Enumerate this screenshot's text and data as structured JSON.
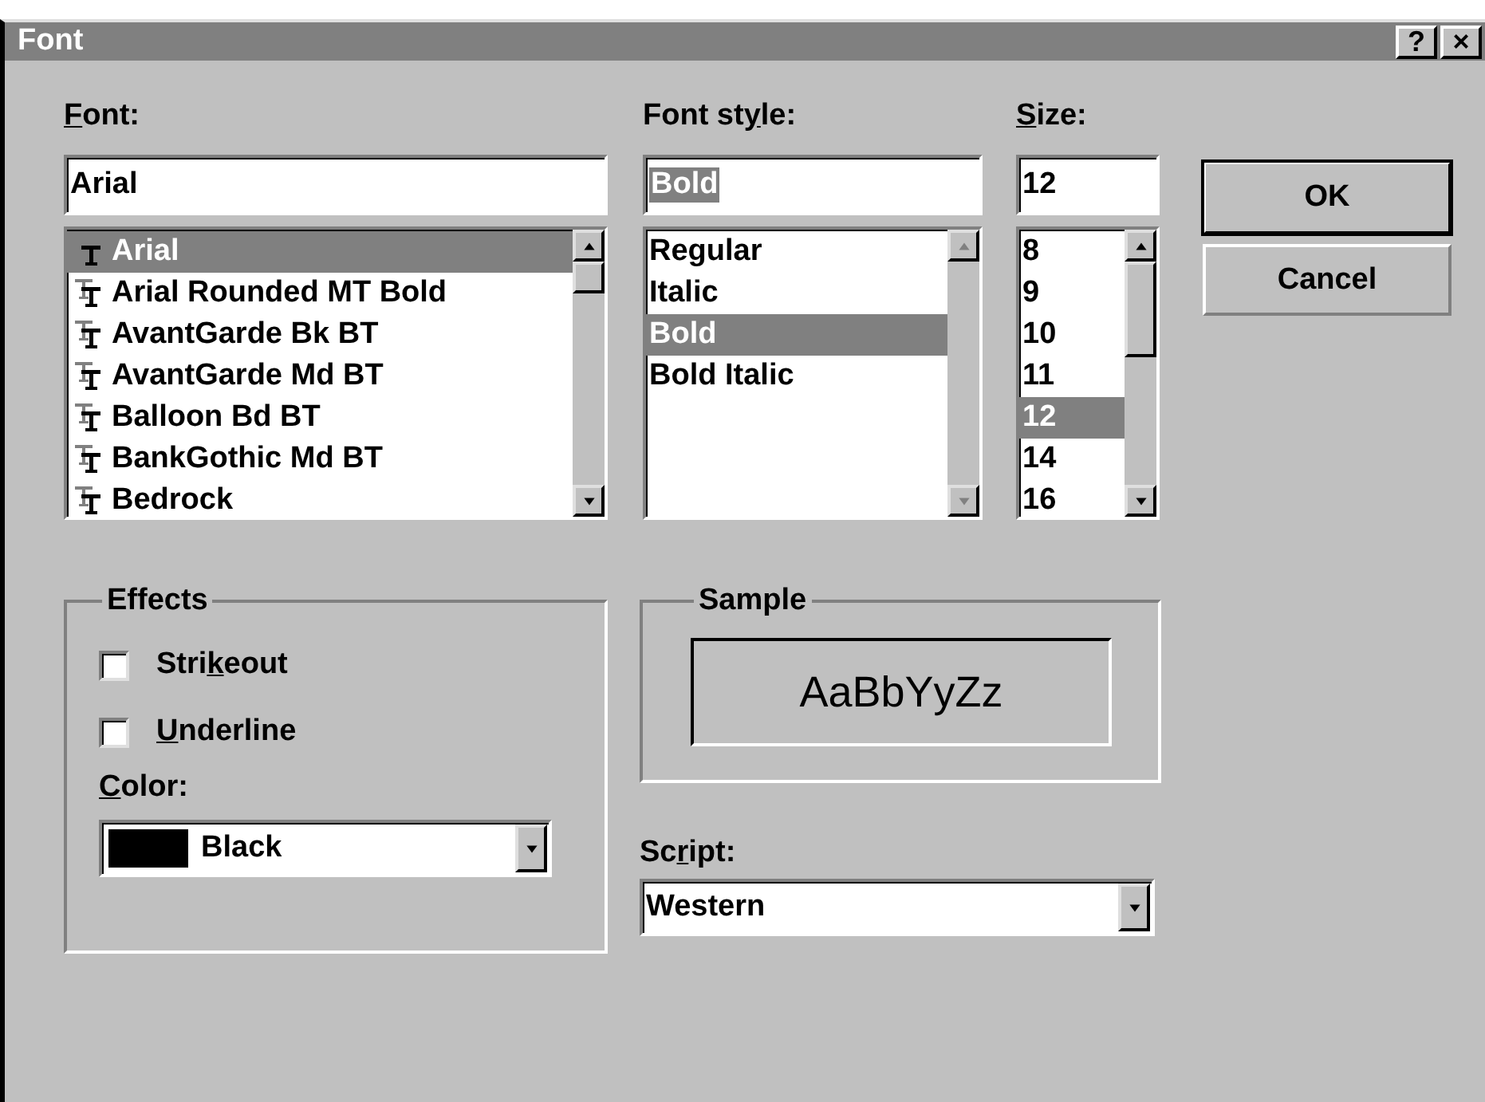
{
  "window": {
    "title": "Font",
    "title_buttons": [
      {
        "kind": "help",
        "label": "?"
      },
      {
        "kind": "close",
        "label": "×"
      }
    ]
  },
  "font": {
    "label": [
      {
        "text": "F",
        "underline": true
      },
      {
        "text": "ont:",
        "underline": false
      }
    ],
    "value": "Arial",
    "items": [
      {
        "name": "Arial",
        "selected": true
      },
      {
        "name": "Arial Rounded MT Bold",
        "selected": false
      },
      {
        "name": "AvantGarde Bk BT",
        "selected": false
      },
      {
        "name": "AvantGarde Md BT",
        "selected": false
      },
      {
        "name": "Balloon Bd BT",
        "selected": false
      },
      {
        "name": "BankGothic Md BT",
        "selected": false
      },
      {
        "name": "Bedrock",
        "selected": false
      }
    ]
  },
  "font_style": {
    "label": [
      {
        "text": "Font st",
        "underline": false
      },
      {
        "text": "y",
        "underline": true
      },
      {
        "text": "le:",
        "underline": false
      }
    ],
    "value": "Bold",
    "text_highlighted": true,
    "scroll_disabled": true,
    "items": [
      {
        "name": "Regular",
        "selected": false
      },
      {
        "name": "Italic",
        "selected": false
      },
      {
        "name": "Bold",
        "selected": true
      },
      {
        "name": "Bold Italic",
        "selected": false
      }
    ]
  },
  "size": {
    "label": [
      {
        "text": "S",
        "underline": true
      },
      {
        "text": "ize:",
        "underline": false
      }
    ],
    "value": "12",
    "items": [
      {
        "name": "8",
        "selected": false
      },
      {
        "name": "9",
        "selected": false
      },
      {
        "name": "10",
        "selected": false
      },
      {
        "name": "11",
        "selected": false
      },
      {
        "name": "12",
        "selected": true
      },
      {
        "name": "14",
        "selected": false
      },
      {
        "name": "16",
        "selected": false
      }
    ]
  },
  "buttons": [
    {
      "label": "OK",
      "default": true
    },
    {
      "label": "Cancel",
      "default": false
    }
  ],
  "effects": {
    "title": "Effects",
    "options": [
      {
        "label": [
          {
            "text": "Stri",
            "underline": false
          },
          {
            "text": "k",
            "underline": true
          },
          {
            "text": "eout",
            "underline": false
          }
        ],
        "checked": false
      },
      {
        "label": [
          {
            "text": "U",
            "underline": true
          },
          {
            "text": "nderline",
            "underline": false
          }
        ],
        "checked": false
      }
    ],
    "color": {
      "label": [
        {
          "text": "C",
          "underline": true
        },
        {
          "text": "olor:",
          "underline": false
        }
      ],
      "value": "Black",
      "color": "#000000"
    }
  },
  "sample": {
    "title": "Sample",
    "text": "AaBbYyZz"
  },
  "script": {
    "label": [
      {
        "text": "Sc",
        "underline": false
      },
      {
        "text": "r",
        "underline": true
      },
      {
        "text": "ipt:",
        "underline": false
      }
    ],
    "value": "Western"
  }
}
